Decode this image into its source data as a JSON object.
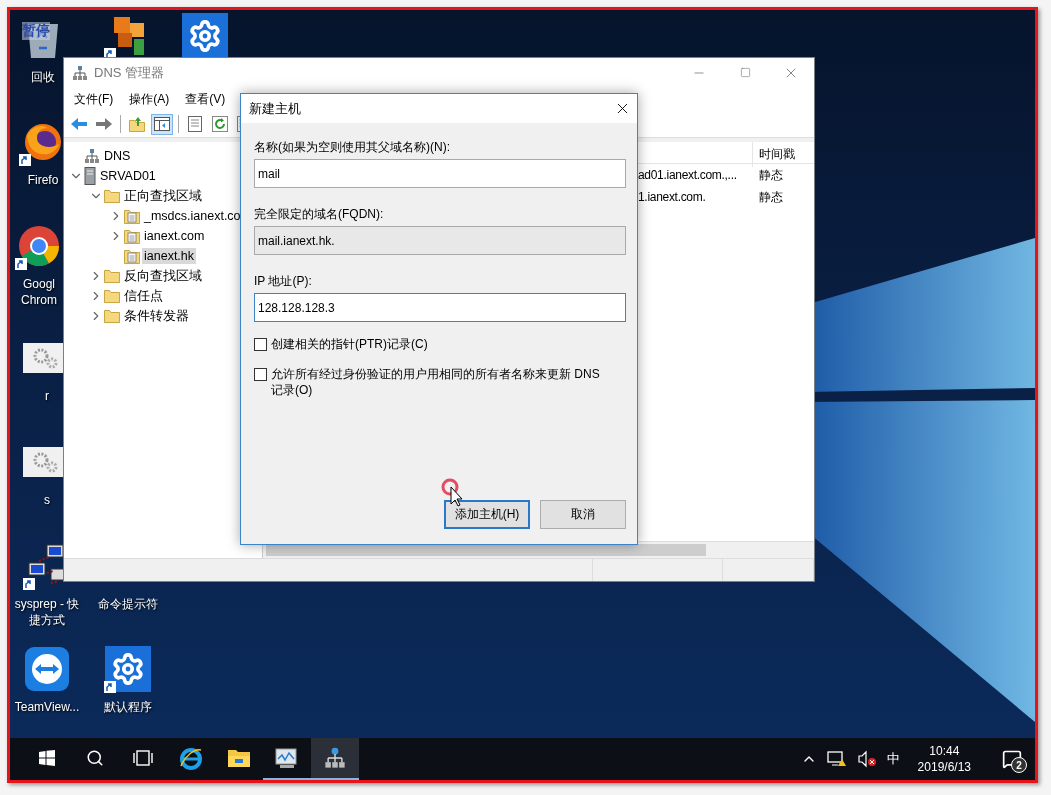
{
  "recorder_overlay": "暂停",
  "desktop_icons": [
    {
      "kind": "recycle-bin",
      "label": "回收",
      "shortcut": false
    },
    {
      "kind": "tiles",
      "shortcut": true
    },
    {
      "kind": "gear",
      "shortcut": false
    },
    {
      "kind": "firefox",
      "label": "Firefo",
      "shortcut": true
    },
    {
      "kind": "chrome",
      "label": "Googl Chrom",
      "shortcut": true
    },
    {
      "kind": "window-gears",
      "label": "r",
      "shortcut": false
    },
    {
      "kind": "window-gears",
      "label": "s",
      "shortcut": false
    },
    {
      "kind": "network",
      "label": "sysprep - 快捷方式",
      "shortcut": true
    },
    {
      "kind": "console",
      "label": "命令提示符",
      "shortcut": false
    },
    {
      "kind": "teamviewer",
      "label": "TeamView...",
      "shortcut": false
    },
    {
      "kind": "gear",
      "label": "默认程序",
      "shortcut": true
    }
  ],
  "dns_window": {
    "title": "DNS 管理器",
    "active": false,
    "menu": [
      "文件(F)",
      "操作(A)",
      "查看(V)"
    ],
    "toolbar": [
      {
        "kind": "back",
        "selected": false
      },
      {
        "kind": "forward",
        "selected": false
      },
      {
        "kind": "separator"
      },
      {
        "kind": "up",
        "selected": false
      },
      {
        "kind": "tree-toggle",
        "selected": true
      },
      {
        "kind": "separator"
      },
      {
        "kind": "properties",
        "selected": false
      },
      {
        "kind": "refresh",
        "selected": false
      },
      {
        "kind": "export",
        "selected": false
      }
    ],
    "tree": [
      {
        "kind": "dns",
        "label": "DNS",
        "selected": false
      },
      {
        "kind": "server",
        "label": "SRVAD01",
        "selected": false,
        "expanded": true,
        "children": [
          {
            "kind": "folder",
            "label": "正向查找区域",
            "selected": false,
            "expanded": true,
            "children": [
              {
                "kind": "zone",
                "label": "_msdcs.ianext.co",
                "selected": false,
                "expanded": false
              },
              {
                "kind": "zone",
                "label": "ianext.com",
                "selected": false,
                "expanded": false
              },
              {
                "kind": "zone",
                "label": "ianext.hk",
                "selected": true
              }
            ]
          },
          {
            "kind": "folder",
            "label": "反向查找区域",
            "selected": false,
            "expanded": false
          },
          {
            "kind": "folder",
            "label": "信任点",
            "selected": false,
            "expanded": false
          },
          {
            "kind": "folder",
            "label": "条件转发器",
            "selected": false,
            "expanded": false
          }
        ]
      }
    ],
    "list": {
      "columns": [
        "",
        "时间戳"
      ],
      "rows": [
        {
          "cells": [
            "ad01.ianext.com.,...",
            "静态"
          ]
        },
        {
          "cells": [
            "1.ianext.com.",
            "静态"
          ]
        }
      ]
    }
  },
  "dialog": {
    "title": "新建主机",
    "fields": [
      {
        "label": "名称(如果为空则使用其父域名称)(N):",
        "value": "mail",
        "readonly": false,
        "focused": false
      },
      {
        "label": "完全限定的域名(FQDN):",
        "value": "mail.ianext.hk.",
        "readonly": true,
        "focused": false
      },
      {
        "label": "IP 地址(P):",
        "value": "128.128.128.3",
        "readonly": false,
        "focused": true
      }
    ],
    "checkboxes": [
      {
        "label": "创建相关的指针(PTR)记录(C)",
        "checked": false
      },
      {
        "label": "允许所有经过身份验证的用户用相同的所有者名称来更新 DNS 记录(O)",
        "checked": false
      }
    ],
    "buttons": [
      {
        "label": "添加主机(H)",
        "default": true
      },
      {
        "label": "取消",
        "default": false
      }
    ]
  },
  "taskbar": {
    "buttons": [
      {
        "kind": "start",
        "running": false,
        "active": false
      },
      {
        "kind": "search",
        "running": false,
        "active": false
      },
      {
        "kind": "task-view",
        "running": false,
        "active": false
      },
      {
        "kind": "ie",
        "running": false,
        "active": false
      },
      {
        "kind": "explorer",
        "running": false,
        "active": false
      },
      {
        "kind": "monitor",
        "running": true,
        "active": false
      },
      {
        "kind": "dns",
        "running": true,
        "active": true
      }
    ],
    "input_method": "中",
    "time": "10:44",
    "date": "2019/6/13",
    "notification_count": "2"
  }
}
